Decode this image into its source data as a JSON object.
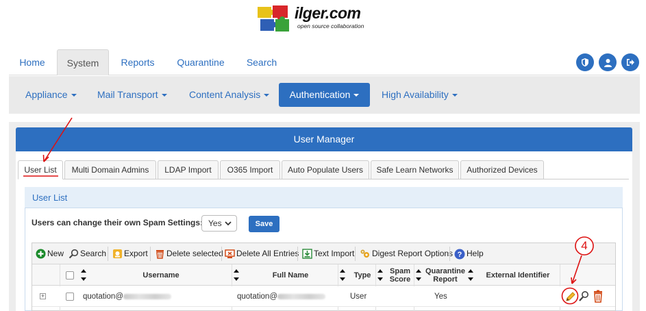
{
  "brand": {
    "name": "ilger.com",
    "tagline": "open source collaboration"
  },
  "top_tabs": [
    {
      "label": "Home"
    },
    {
      "label": "System",
      "active": true
    },
    {
      "label": "Reports"
    },
    {
      "label": "Quarantine"
    },
    {
      "label": "Search"
    }
  ],
  "top_icons": [
    "shield-icon",
    "user-icon",
    "logout-icon"
  ],
  "subnav": [
    {
      "label": "Appliance"
    },
    {
      "label": "Mail Transport"
    },
    {
      "label": "Content Analysis"
    },
    {
      "label": "Authentication",
      "active": true
    },
    {
      "label": "High Availability"
    }
  ],
  "panel": {
    "title": "User Manager"
  },
  "inner_tabs": [
    {
      "label": "User List",
      "active": true
    },
    {
      "label": "Multi Domain Admins"
    },
    {
      "label": "LDAP Import"
    },
    {
      "label": "O365 Import"
    },
    {
      "label": "Auto Populate Users"
    },
    {
      "label": "Safe Learn Networks"
    },
    {
      "label": "Authorized Devices"
    }
  ],
  "user_list": {
    "heading": "User List",
    "spam_label": "Users can change their own Spam Settings:",
    "spam_value": "Yes",
    "save_label": "Save"
  },
  "toolbar": [
    {
      "label": "New",
      "icon": "plus-circle-icon"
    },
    {
      "label": "Search",
      "icon": "search-icon"
    },
    {
      "label": "Export",
      "icon": "export-icon"
    },
    {
      "label": "Delete selected",
      "icon": "trash-icon"
    },
    {
      "label": "Delete All Entries",
      "icon": "delete-all-icon"
    },
    {
      "label": "Text Import",
      "icon": "import-icon"
    },
    {
      "label": "Digest Report Options",
      "icon": "gears-icon"
    },
    {
      "label": "Help",
      "icon": "help-icon"
    }
  ],
  "columns": {
    "username": "Username",
    "fullname": "Full Name",
    "type": "Type",
    "spam_score": "Spam Score",
    "quarantine": "Quarantine Report",
    "external": "External Identifier"
  },
  "rows": [
    {
      "username": "quotation@",
      "fullname": "quotation@",
      "type": "User",
      "quarantine": "Yes"
    }
  ],
  "annotation": {
    "number": "4"
  },
  "colors": {
    "accent": "#2d6fc0",
    "annotation": "#dd1111"
  }
}
